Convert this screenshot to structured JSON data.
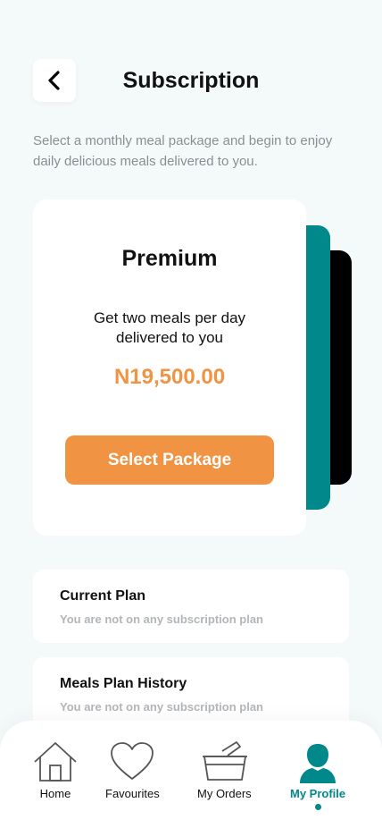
{
  "header": {
    "title": "Subscription",
    "subtitle": "Select a monthly meal package and begin to enjoy daily delicious meals delivered to you."
  },
  "plan": {
    "name": "Premium",
    "description": "Get two meals per day delivered to you",
    "price": "N19,500.00",
    "button_label": "Select Package"
  },
  "current_plan": {
    "heading": "Current Plan",
    "status": "You are not on any subscription plan"
  },
  "history": {
    "heading": "Meals Plan History",
    "status": "You are not on any subscription plan"
  },
  "nav": {
    "items": [
      {
        "label": "Home",
        "icon": "home-icon"
      },
      {
        "label": "Favourites",
        "icon": "heart-icon"
      },
      {
        "label": "My Orders",
        "icon": "basket-icon"
      },
      {
        "label": "My Profile",
        "icon": "profile-icon"
      }
    ],
    "active": "My Profile"
  },
  "colors": {
    "accent": "#00888a",
    "orange": "#f09444",
    "background": "#f4f9f9"
  }
}
